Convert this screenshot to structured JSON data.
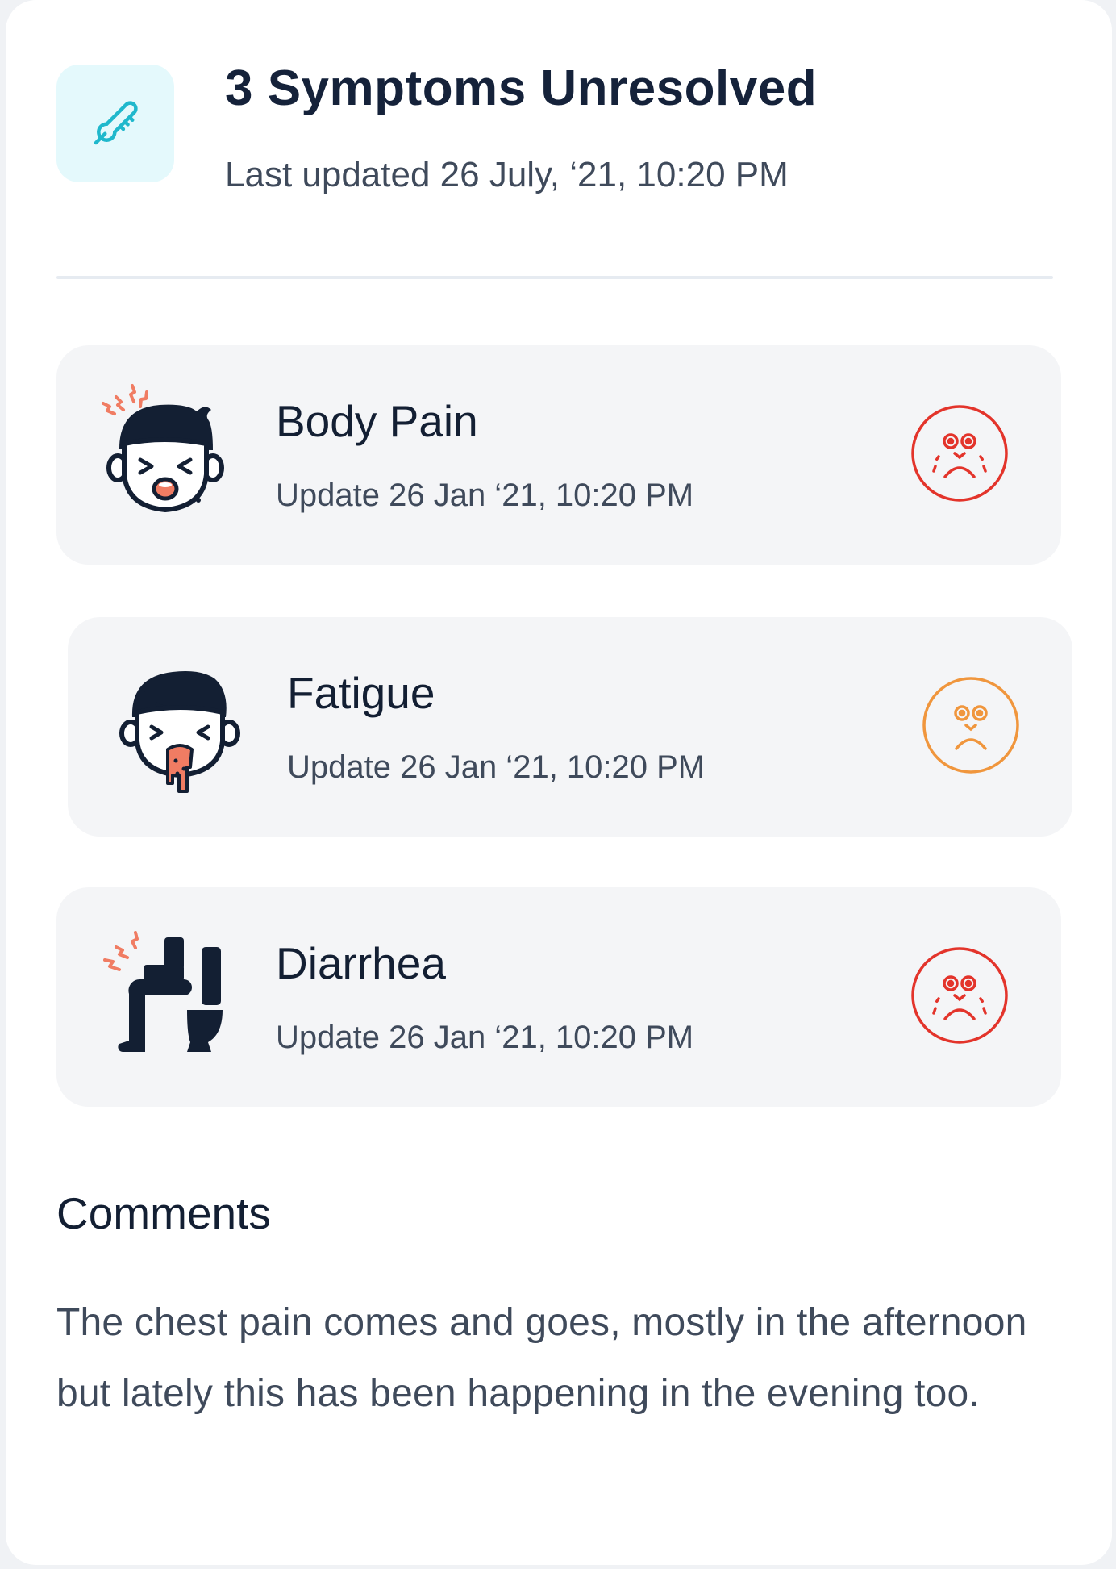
{
  "header": {
    "title": "3 Symptoms Unresolved",
    "subtitle": "Last updated 26 July, ‘21, 10:20 PM",
    "icon": "thermometer-icon"
  },
  "symptoms": [
    {
      "name": "Body Pain",
      "updated": "Update 26 Jan ‘21, 10:20 PM",
      "icon": "body-pain-face-icon",
      "severity": "high",
      "severity_color": "#e3342b"
    },
    {
      "name": "Fatigue",
      "updated": "Update 26 Jan ‘21, 10:20 PM",
      "icon": "vomiting-face-icon",
      "severity": "medium",
      "severity_color": "#f0963d"
    },
    {
      "name": "Diarrhea",
      "updated": "Update 26 Jan ‘21, 10:20 PM",
      "icon": "toilet-person-icon",
      "severity": "high",
      "severity_color": "#e3342b"
    }
  ],
  "comments": {
    "title": "Comments",
    "text": "The chest pain comes and goes, mostly in the afternoon but lately this has been happening in the evening too."
  },
  "colors": {
    "accent": "#1fb8cc",
    "text_primary": "#131f33",
    "text_secondary": "#3f4a5b",
    "pain_accent": "#f07c63"
  }
}
